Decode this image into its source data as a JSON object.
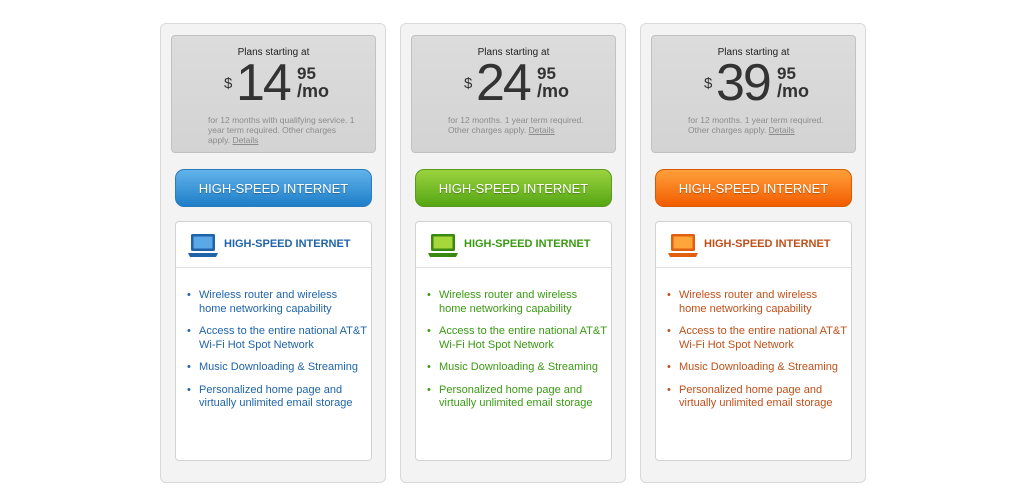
{
  "plans": [
    {
      "starting_label": "Plans starting at",
      "currency": "$",
      "amount": "14",
      "cents": "95",
      "period": "/mo",
      "fine_print": "for 12 months with qualifying service. 1 year term required. Other charges apply.",
      "details_link": "Details",
      "button_label": "HIGH-SPEED INTERNET",
      "card_title": "HIGH-SPEED INTERNET",
      "features": [
        "Wireless router and wireless home networking capability",
        "Access to the entire national AT&T Wi-Fi Hot Spot Network",
        "Music Downloading & Streaming",
        "Personalized home page and virtually unlimited email storage"
      ],
      "accent_color": "#1f64a8",
      "icon": "laptop-icon"
    },
    {
      "starting_label": "Plans starting at",
      "currency": "$",
      "amount": "24",
      "cents": "95",
      "period": "/mo",
      "fine_print": "for 12 months. 1 year term required. Other charges apply.",
      "details_link": "Details",
      "button_label": "HIGH-SPEED INTERNET",
      "card_title": "HIGH-SPEED INTERNET",
      "features": [
        "Wireless router and wireless home networking capability",
        "Access to the entire national AT&T Wi-Fi Hot Spot Network",
        "Music Downloading & Streaming",
        "Personalized home page and virtually unlimited email storage"
      ],
      "accent_color": "#3a9a13",
      "icon": "laptop-icon"
    },
    {
      "starting_label": "Plans starting at",
      "currency": "$",
      "amount": "39",
      "cents": "95",
      "period": "/mo",
      "fine_print": "for 12 months. 1 year term required. Other charges apply.",
      "details_link": "Details",
      "button_label": "HIGH-SPEED INTERNET",
      "card_title": "HIGH-SPEED INTERNET",
      "features": [
        "Wireless router and wireless home networking capability",
        "Access to the entire national AT&T Wi-Fi Hot Spot Network",
        "Music Downloading & Streaming",
        "Personalized home page and virtually unlimited email storage"
      ],
      "accent_color": "#c0501a",
      "icon": "laptop-icon"
    }
  ],
  "bullet_char": "•"
}
